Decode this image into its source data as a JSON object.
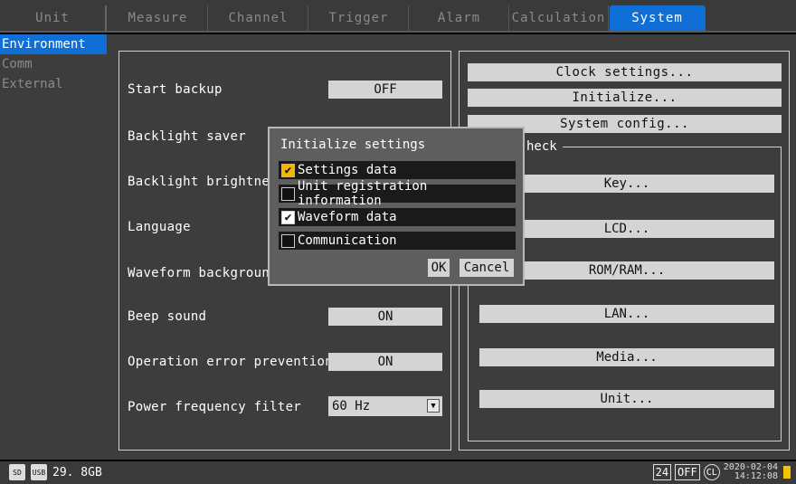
{
  "tabs": [
    {
      "label": "Unit",
      "active": false
    },
    {
      "label": "Measure",
      "active": false
    },
    {
      "label": "Channel",
      "active": false
    },
    {
      "label": "Trigger",
      "active": false
    },
    {
      "label": "Alarm",
      "active": false
    },
    {
      "label": "Calculation",
      "active": false
    },
    {
      "label": "System",
      "active": true
    }
  ],
  "sidebar": {
    "items": [
      {
        "label": "Environment",
        "active": true
      },
      {
        "label": "Comm",
        "active": false
      },
      {
        "label": "External",
        "active": false
      }
    ]
  },
  "settings": {
    "start_backup": {
      "label": "Start backup",
      "value": "OFF"
    },
    "backlight_saver": {
      "label": "Backlight saver"
    },
    "backlight_brightness": {
      "label": "Backlight brightness"
    },
    "language": {
      "label": "Language"
    },
    "waveform_background": {
      "label": "Waveform background"
    },
    "beep_sound": {
      "label": "Beep sound",
      "value": "ON"
    },
    "operation_error_prevention": {
      "label": "Operation error prevention",
      "value": "ON"
    },
    "power_frequency_filter": {
      "label": "Power frequency filter",
      "value": "60 Hz"
    }
  },
  "right_panel": {
    "clock_settings": "Clock settings...",
    "initialize": "Initialize...",
    "system_config": "System config...",
    "check_group_label": "heck",
    "check_buttons": [
      "Key...",
      "LCD...",
      "ROM/RAM...",
      "LAN...",
      "Media...",
      "Unit..."
    ]
  },
  "dialog": {
    "title": "Initialize settings",
    "options": [
      {
        "label": "Settings data",
        "checked": true
      },
      {
        "label": "Unit registration information",
        "checked": false
      },
      {
        "label": "Waveform data",
        "checked": true
      },
      {
        "label": "Communication",
        "checked": false
      }
    ],
    "ok": "OK",
    "cancel": "Cancel"
  },
  "status": {
    "sd_label": "SD",
    "usb_label": "USB",
    "storage": "29. 8GB",
    "badge_24": "24",
    "badge_off": "OFF",
    "badge_cl": "CL",
    "date": "2020-02-04",
    "time": "14:12:08"
  },
  "colors": {
    "accent": "#0f6fd6",
    "highlight": "#f2b700"
  }
}
